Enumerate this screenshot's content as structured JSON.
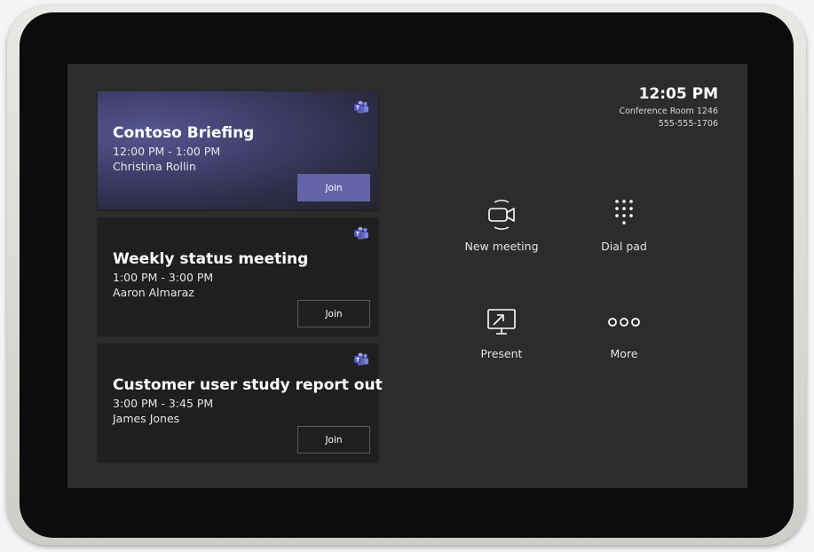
{
  "status": {
    "time": "12:05 PM",
    "room": "Conference Room 1246",
    "phone": "555-555-1706"
  },
  "meetings": [
    {
      "title": "Contoso Briefing",
      "time": "12:00 PM - 1:00 PM",
      "organizer": "Christina Rollin",
      "join_label": "Join"
    },
    {
      "title": "Weekly status meeting",
      "time": "1:00 PM - 3:00 PM",
      "organizer": "Aaron Almaraz",
      "join_label": "Join"
    },
    {
      "title": "Customer user study report out",
      "time": "3:00 PM - 3:45 PM",
      "organizer": "James Jones",
      "join_label": "Join"
    }
  ],
  "actions": {
    "new_meeting": {
      "label": "New meeting",
      "icon": "video-camera-icon"
    },
    "dial_pad": {
      "label": "Dial pad",
      "icon": "dial-pad-icon"
    },
    "present": {
      "label": "Present",
      "icon": "share-screen-icon"
    },
    "more": {
      "label": "More",
      "icon": "more-icon"
    }
  },
  "colors": {
    "accent": "#6264a7",
    "screen_bg": "#2c2c2c",
    "card_bg": "#1f1f1f"
  }
}
